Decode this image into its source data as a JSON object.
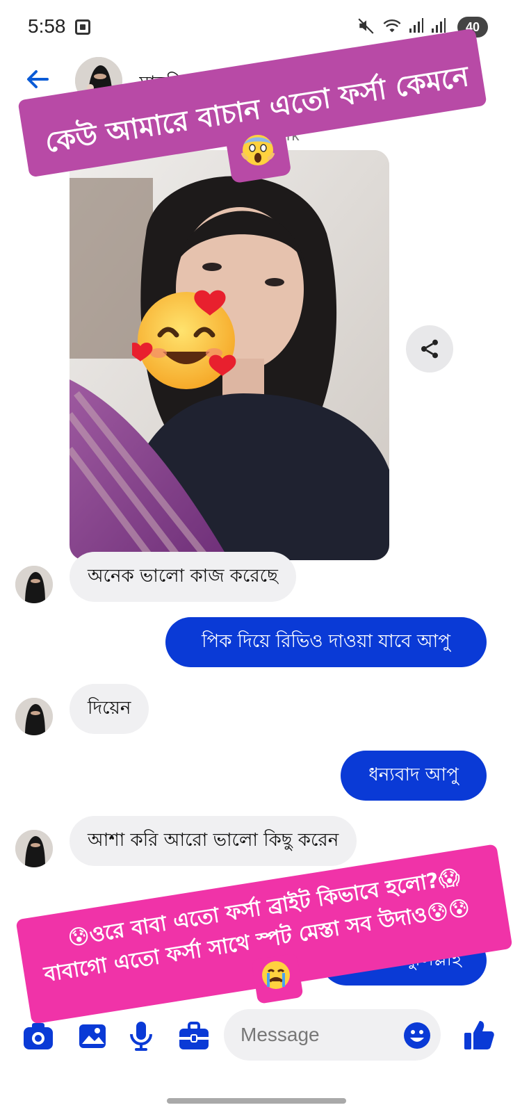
{
  "status_bar": {
    "time": "5:58",
    "battery": "40",
    "icons": [
      "screenshot-icon",
      "mute-icon",
      "wifi-icon",
      "signal-icon",
      "signal-icon"
    ]
  },
  "header": {
    "contact_name": "মারফিয়া জান্না",
    "subtitle": "work",
    "back_icon": "arrow-left-icon"
  },
  "overlay": {
    "top_caption": "কেউ আমারে বাচান এতো ফর্সা কেমনে",
    "top_caption_emoji": "scream-emoji",
    "bottom_caption_line1": "😰ওরে বাবা এতো ফর্সা ব্রাইট কিভাবে হলো?😱",
    "bottom_caption_line2": "বাবাগো এতো ফর্সা সাথে স্পট মেস্তা  সব উদাও😰😰",
    "bottom_caption_emoji": "crying-emoji",
    "face_emoji": "smiling-face-with-hearts-emoji"
  },
  "messages": [
    {
      "direction": "in",
      "text": "অনেক ভালো কাজ করেছে"
    },
    {
      "direction": "out",
      "text": "পিক দিয়ে রিভিও দাওয়া যাবে আপু"
    },
    {
      "direction": "in",
      "text": "দিয়েন"
    },
    {
      "direction": "out",
      "text": "ধন্যবাদ  আপু"
    },
    {
      "direction": "in",
      "text": "আশা করি আরো ভালো কিছু করেন"
    },
    {
      "direction": "out",
      "text": "আলহামদুলিল্লাহ"
    }
  ],
  "composer": {
    "placeholder": "Message",
    "tools": [
      "camera-icon",
      "image-icon",
      "microphone-icon",
      "briefcase-icon"
    ],
    "emoji_icon": "smiley-icon",
    "like_icon": "thumbs-up-icon"
  },
  "colors": {
    "accent_blue": "#0a3ad6",
    "top_caption_bg": "#b84aa6",
    "bottom_caption_bg": "#f033a8",
    "incoming_bubble": "#f0f0f2"
  }
}
